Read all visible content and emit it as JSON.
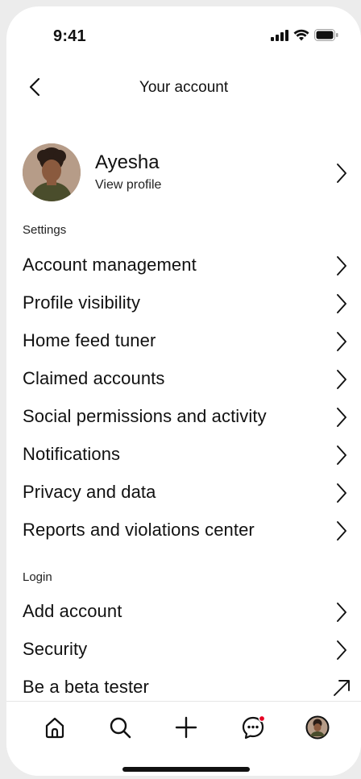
{
  "status_bar": {
    "time": "9:41"
  },
  "header": {
    "title": "Your account"
  },
  "profile": {
    "name": "Ayesha",
    "link": "View profile"
  },
  "sections": [
    {
      "label": "Settings",
      "items": [
        {
          "label": "Account management",
          "icon": "chevron-right-icon"
        },
        {
          "label": "Profile visibility",
          "icon": "chevron-right-icon"
        },
        {
          "label": "Home feed tuner",
          "icon": "chevron-right-icon"
        },
        {
          "label": "Claimed accounts",
          "icon": "chevron-right-icon"
        },
        {
          "label": "Social permissions and activity",
          "icon": "chevron-right-icon"
        },
        {
          "label": "Notifications",
          "icon": "chevron-right-icon"
        },
        {
          "label": "Privacy and data",
          "icon": "chevron-right-icon"
        },
        {
          "label": "Reports and violations center",
          "icon": "chevron-right-icon"
        }
      ]
    },
    {
      "label": "Login",
      "items": [
        {
          "label": "Add account",
          "icon": "chevron-right-icon"
        },
        {
          "label": "Security",
          "icon": "chevron-right-icon"
        },
        {
          "label": "Be a beta tester",
          "icon": "external-arrow-icon"
        }
      ]
    }
  ],
  "tab_bar": {
    "tabs": [
      "home-icon",
      "search-icon",
      "plus-icon",
      "messages-icon",
      "profile-avatar-icon"
    ],
    "notification_dot_color": "#e60023"
  },
  "colors": {
    "text": "#111111",
    "background": "#ffffff"
  }
}
